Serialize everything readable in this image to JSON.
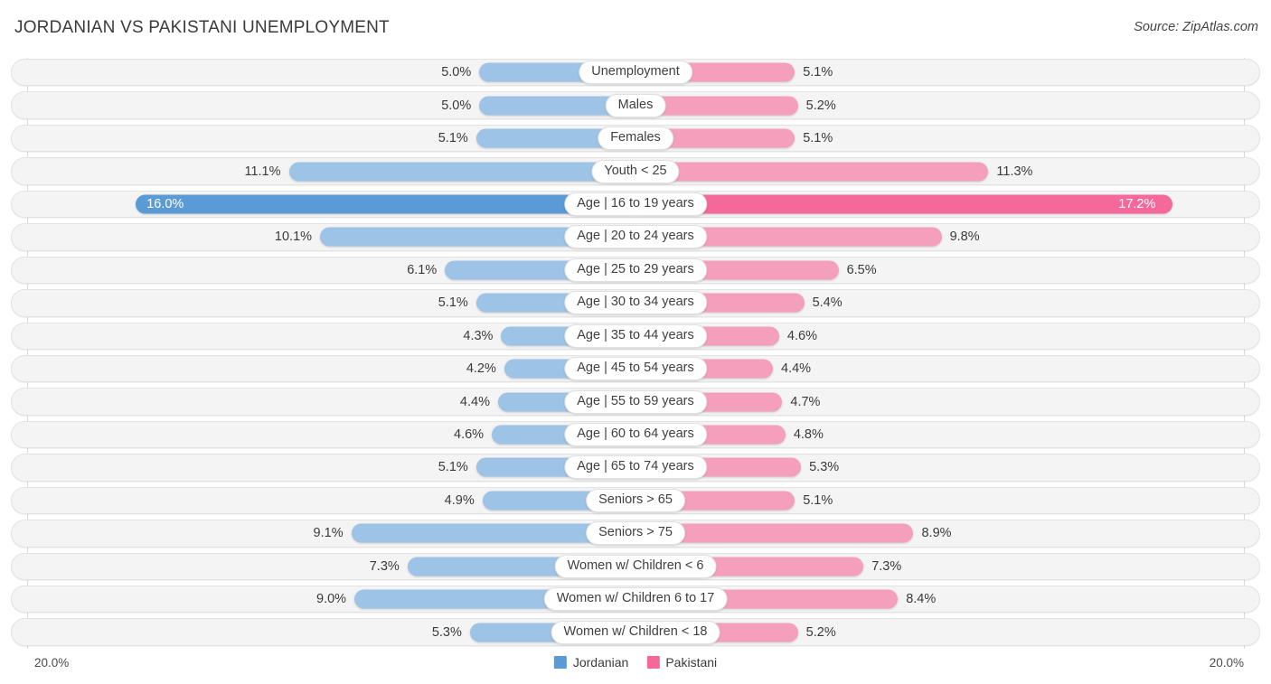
{
  "header": {
    "title": "JORDANIAN VS PAKISTANI UNEMPLOYMENT",
    "source": "Source: ZipAtlas.com"
  },
  "footer": {
    "axis_min_label": "20.0%",
    "axis_max_label": "20.0%",
    "legend": [
      {
        "label": "Jordanian",
        "color": "#5b9bd5"
      },
      {
        "label": "Pakistani",
        "color": "#f4689a"
      }
    ]
  },
  "colors": {
    "jordanian_light": "#9dc3e6",
    "jordanian_dark": "#5b9bd5",
    "pakistani_light": "#f4a0bd",
    "pakistani_dark": "#f4689a",
    "track": "#f4f4f4",
    "track_border": "#e3e3e3",
    "gridline": "#d8d8d8"
  },
  "chart_data": {
    "type": "bar",
    "subtype": "diverging-horizontal-bar",
    "title": "JORDANIAN VS PAKISTANI UNEMPLOYMENT",
    "xlabel": "",
    "ylabel": "",
    "axis_max": 20.0,
    "axis_min": 20.0,
    "unit": "%",
    "grid": true,
    "legend_position": "bottom-center",
    "categories": [
      "Unemployment",
      "Males",
      "Females",
      "Youth < 25",
      "Age | 16 to 19 years",
      "Age | 20 to 24 years",
      "Age | 25 to 29 years",
      "Age | 30 to 34 years",
      "Age | 35 to 44 years",
      "Age | 45 to 54 years",
      "Age | 55 to 59 years",
      "Age | 60 to 64 years",
      "Age | 65 to 74 years",
      "Seniors > 65",
      "Seniors > 75",
      "Women w/ Children < 6",
      "Women w/ Children 6 to 17",
      "Women w/ Children < 18"
    ],
    "series": [
      {
        "name": "Jordanian",
        "color": "#9dc3e6",
        "values": [
          5.0,
          5.0,
          5.1,
          11.1,
          16.0,
          10.1,
          6.1,
          5.1,
          4.3,
          4.2,
          4.4,
          4.6,
          5.1,
          4.9,
          9.1,
          7.3,
          9.0,
          5.3
        ],
        "labels": [
          "5.0%",
          "5.0%",
          "5.1%",
          "11.1%",
          "16.0%",
          "10.1%",
          "6.1%",
          "5.1%",
          "4.3%",
          "4.2%",
          "4.4%",
          "4.6%",
          "5.1%",
          "4.9%",
          "9.1%",
          "7.3%",
          "9.0%",
          "5.3%"
        ]
      },
      {
        "name": "Pakistani",
        "color": "#f4a0bd",
        "values": [
          5.1,
          5.2,
          5.1,
          11.3,
          17.2,
          9.8,
          6.5,
          5.4,
          4.6,
          4.4,
          4.7,
          4.8,
          5.3,
          5.1,
          8.9,
          7.3,
          8.4,
          5.2
        ],
        "labels": [
          "5.1%",
          "5.2%",
          "5.1%",
          "11.3%",
          "17.2%",
          "9.8%",
          "6.5%",
          "5.4%",
          "4.6%",
          "4.4%",
          "4.7%",
          "4.8%",
          "5.3%",
          "5.1%",
          "8.9%",
          "7.3%",
          "8.4%",
          "5.2%"
        ]
      }
    ]
  }
}
